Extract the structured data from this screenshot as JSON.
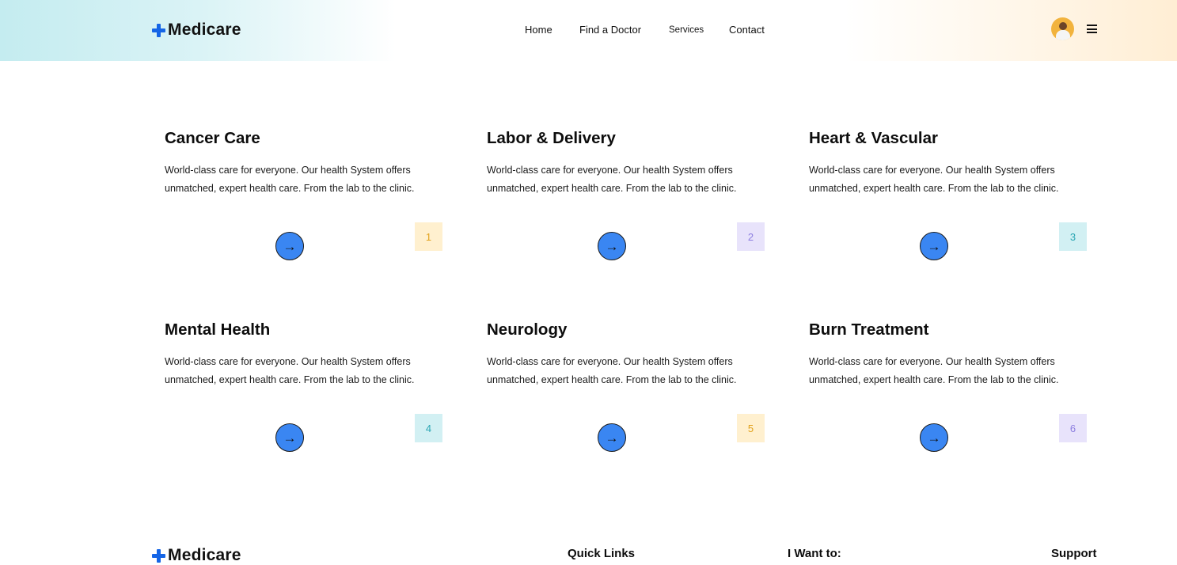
{
  "brand": {
    "name": "Medicare",
    "accent": "#1565e6"
  },
  "nav": {
    "items": [
      "Home",
      "Find a Doctor",
      "Services",
      "Contact"
    ]
  },
  "header_icons": {
    "avatar": "user-avatar",
    "menu": "hamburger-menu-icon"
  },
  "services": [
    {
      "title": "Cancer Care",
      "description": "World-class care for everyone. Our health System offers unmatched, expert health care. From the lab to the clinic.",
      "number": "1",
      "badge_bg": "#fff0cf",
      "badge_fg": "#e2a21c"
    },
    {
      "title": "Labor & Delivery",
      "description": "World-class care for everyone. Our health System offers unmatched, expert health care. From the lab to the clinic.",
      "number": "2",
      "badge_bg": "#e8e3fb",
      "badge_fg": "#8d7fe0"
    },
    {
      "title": "Heart & Vascular",
      "description": "World-class care for everyone. Our health System offers unmatched, expert health care. From the lab to the clinic.",
      "number": "3",
      "badge_bg": "#d2f0f3",
      "badge_fg": "#2aa6b3"
    },
    {
      "title": "Mental Health",
      "description": "World-class care for everyone. Our health System offers unmatched, expert health care. From the lab to the clinic.",
      "number": "4",
      "badge_bg": "#d2f0f3",
      "badge_fg": "#2aa6b3"
    },
    {
      "title": "Neurology",
      "description": "World-class care for everyone. Our health System offers unmatched, expert health care. From the lab to the clinic.",
      "number": "5",
      "badge_bg": "#fff0cf",
      "badge_fg": "#e2a21c"
    },
    {
      "title": "Burn Treatment",
      "description": "World-class care for everyone. Our health System offers unmatched, expert health care. From the lab to the clinic.",
      "number": "6",
      "badge_bg": "#e8e3fb",
      "badge_fg": "#8d7fe0"
    }
  ],
  "arrow_icon": "arrow-right-icon",
  "footer": {
    "brand": "Medicare",
    "headings": [
      "Quick Links",
      "I Want to:",
      "Support"
    ]
  }
}
